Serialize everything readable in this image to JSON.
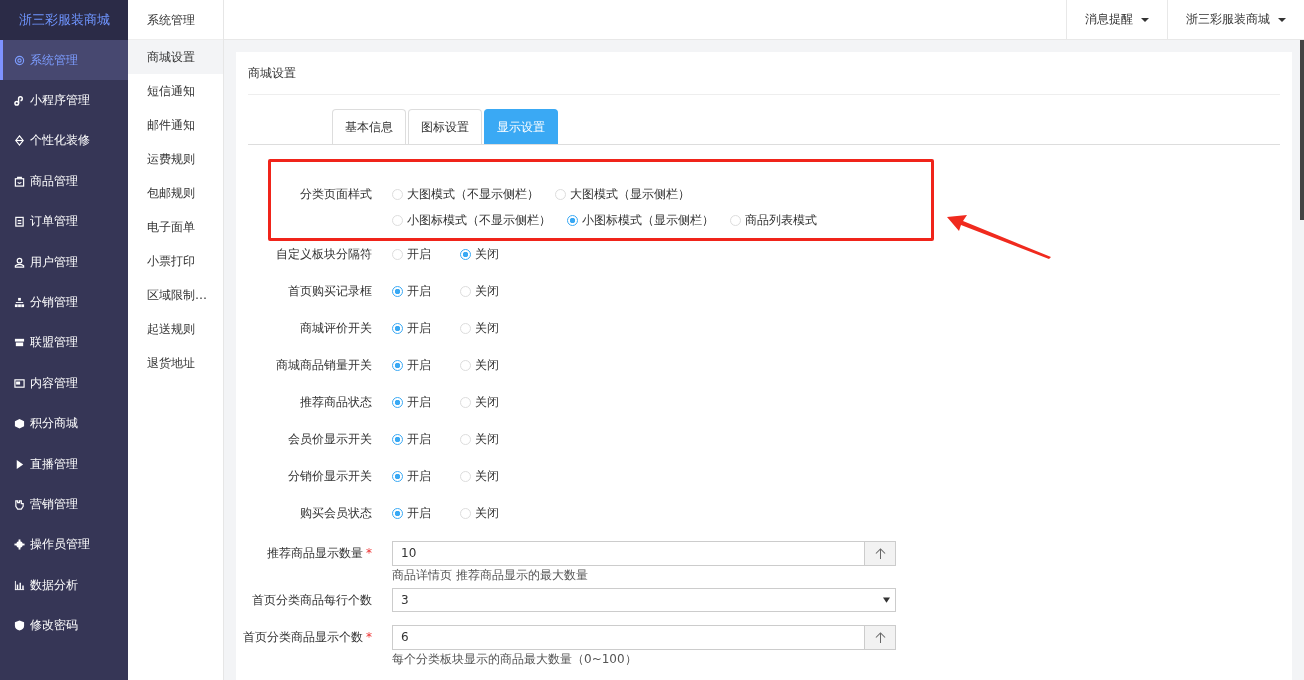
{
  "sidebar": {
    "logo": "浙三彩服装商城",
    "items": [
      {
        "label": "系统管理",
        "selected": true
      },
      {
        "label": "小程序管理",
        "selected": false
      },
      {
        "label": "个性化装修",
        "selected": false
      },
      {
        "label": "商品管理",
        "selected": false
      },
      {
        "label": "订单管理",
        "selected": false
      },
      {
        "label": "用户管理",
        "selected": false
      },
      {
        "label": "分销管理",
        "selected": false
      },
      {
        "label": "联盟管理",
        "selected": false
      },
      {
        "label": "内容管理",
        "selected": false
      },
      {
        "label": "积分商城",
        "selected": false
      },
      {
        "label": "直播管理",
        "selected": false
      },
      {
        "label": "营销管理",
        "selected": false
      },
      {
        "label": "操作员管理",
        "selected": false
      },
      {
        "label": "数据分析",
        "selected": false
      },
      {
        "label": "修改密码",
        "selected": false
      }
    ]
  },
  "submenu": {
    "title": "系统管理",
    "items": [
      {
        "label": "商城设置",
        "selected": true
      },
      {
        "label": "短信通知",
        "selected": false
      },
      {
        "label": "邮件通知",
        "selected": false
      },
      {
        "label": "运费规则",
        "selected": false
      },
      {
        "label": "包邮规则",
        "selected": false
      },
      {
        "label": "电子面单",
        "selected": false
      },
      {
        "label": "小票打印",
        "selected": false
      },
      {
        "label": "区域限制…",
        "selected": false
      },
      {
        "label": "起送规则",
        "selected": false
      },
      {
        "label": "退货地址",
        "selected": false
      }
    ]
  },
  "topbar": {
    "menus": [
      "消息提醒",
      "浙三彩服装商城"
    ]
  },
  "card": {
    "title": "商城设置",
    "tabs": [
      {
        "label": "基本信息",
        "selected": false
      },
      {
        "label": "图标设置",
        "selected": false
      },
      {
        "label": "显示设置",
        "selected": true
      }
    ],
    "highlighted_group": {
      "label": "分类页面样式",
      "lines": [
        [
          {
            "label": "大图模式（不显示侧栏）",
            "selected": false
          },
          {
            "label": "大图模式（显示侧栏）",
            "selected": false
          }
        ],
        [
          {
            "label": "小图标模式（不显示侧栏）",
            "selected": false
          },
          {
            "label": "小图标模式（显示侧栏）",
            "selected": true
          },
          {
            "label": "商品列表模式",
            "selected": false
          }
        ]
      ]
    },
    "fields": [
      {
        "kind": "radio",
        "label": "自定义板块分隔符",
        "options": [
          {
            "label": "开启",
            "selected": false
          },
          {
            "label": "关闭",
            "selected": true
          }
        ]
      },
      {
        "kind": "radio",
        "label": "首页购买记录框",
        "options": [
          {
            "label": "开启",
            "selected": true
          },
          {
            "label": "关闭",
            "selected": false
          }
        ]
      },
      {
        "kind": "radio",
        "label": "商城评价开关",
        "options": [
          {
            "label": "开启",
            "selected": true
          },
          {
            "label": "关闭",
            "selected": false
          }
        ]
      },
      {
        "kind": "radio",
        "label": "商城商品销量开关",
        "options": [
          {
            "label": "开启",
            "selected": true
          },
          {
            "label": "关闭",
            "selected": false
          }
        ]
      },
      {
        "kind": "radio",
        "label": "推荐商品状态",
        "options": [
          {
            "label": "开启",
            "selected": true
          },
          {
            "label": "关闭",
            "selected": false
          }
        ]
      },
      {
        "kind": "radio",
        "label": "会员价显示开关",
        "options": [
          {
            "label": "开启",
            "selected": true
          },
          {
            "label": "关闭",
            "selected": false
          }
        ]
      },
      {
        "kind": "radio",
        "label": "分销价显示开关",
        "options": [
          {
            "label": "开启",
            "selected": true
          },
          {
            "label": "关闭",
            "selected": false
          }
        ]
      },
      {
        "kind": "radio",
        "label": "购买会员状态",
        "options": [
          {
            "label": "开启",
            "selected": true
          },
          {
            "label": "关闭",
            "selected": false
          }
        ]
      },
      {
        "kind": "number",
        "label": "推荐商品显示数量",
        "required_mark": "*",
        "value": "10",
        "hint": "商品详情页 推荐商品显示的最大数量"
      },
      {
        "kind": "select",
        "label": "首页分类商品每行个数",
        "value": "3"
      },
      {
        "kind": "number",
        "label": "首页分类商品显示个数",
        "required_mark": "*",
        "value": "6",
        "hint": "每个分类板块显示的商品最大数量（0~100）"
      }
    ]
  }
}
